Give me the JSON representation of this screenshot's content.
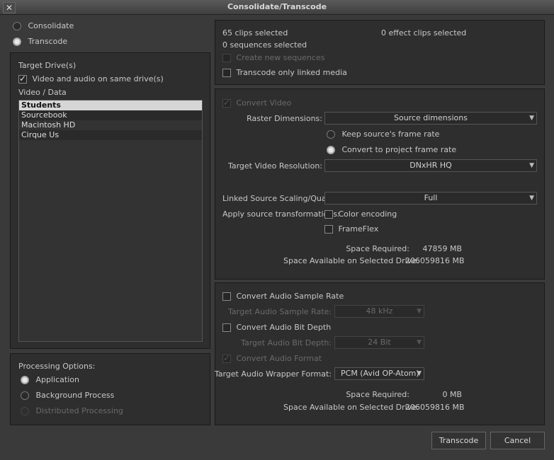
{
  "window": {
    "title": "Consolidate/Transcode",
    "close_glyph": "✕"
  },
  "mode": {
    "consolidate": "Consolidate",
    "transcode": "Transcode"
  },
  "target": {
    "heading": "Target Drive(s)",
    "same_drive": "Video and audio on same drive(s)",
    "video_data": "Video / Data",
    "drives": [
      "Students",
      "Sourcebook",
      "Macintosh HD",
      "Cirque Us"
    ]
  },
  "processing": {
    "heading": "Processing Options:",
    "application": "Application",
    "background": "Background Process",
    "distributed": "Distributed Processing"
  },
  "selection": {
    "clips": "65 clips selected",
    "effect_clips": "0 effect clips selected",
    "sequences": "0 sequences selected",
    "create_new": "Create new sequences",
    "linked_only": "Transcode only linked media"
  },
  "video": {
    "convert": "Convert Video",
    "raster_label": "Raster Dimensions:",
    "raster_value": "Source dimensions",
    "keep_rate": "Keep source's frame rate",
    "convert_rate": "Convert to project frame rate",
    "resolution_label": "Target Video Resolution:",
    "resolution_value": "DNxHR HQ",
    "scaling_label": "Linked Source Scaling/Quality:",
    "scaling_value": "Full",
    "transform_label": "Apply source transformations:",
    "color_encoding": "Color encoding",
    "frameflex": "FrameFlex",
    "space_required_label": "Space Required:",
    "space_required_value": "47859 MB",
    "space_available_label": "Space Available on Selected Drive:",
    "space_available_value": "206059816 MB"
  },
  "audio": {
    "convert_sample_rate": "Convert Audio Sample Rate",
    "sample_rate_label": "Target Audio Sample Rate:",
    "sample_rate_value": "48 kHz",
    "convert_bit_depth": "Convert Audio Bit Depth",
    "bit_depth_label": "Target Audio Bit Depth:",
    "bit_depth_value": "24 Bit",
    "convert_format": "Convert Audio Format",
    "wrapper_label": "Target Audio Wrapper Format:",
    "wrapper_value": "PCM  (Avid OP-Atom)",
    "space_required_label": "Space Required:",
    "space_required_value": "0 MB",
    "space_available_label": "Space Available on Selected Drive:",
    "space_available_value": "206059816 MB"
  },
  "buttons": {
    "transcode": "Transcode",
    "cancel": "Cancel"
  },
  "icons": {
    "dropdown": "chevron-down-icon",
    "check": "checkmark-icon"
  }
}
